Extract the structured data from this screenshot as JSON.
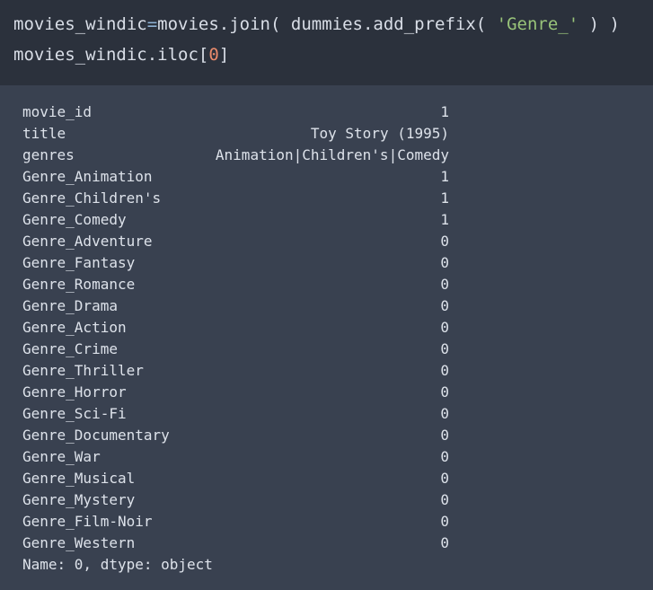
{
  "code": {
    "line1": {
      "a": "movies_windic",
      "eq": "=",
      "b": "movies.join( dummies.add_prefix( ",
      "str": "'Genre_'",
      "c": " ) )"
    },
    "line2": {
      "a": "movies_windic.iloc[",
      "num": "0",
      "b": "]"
    }
  },
  "output": {
    "rows": [
      {
        "key": "movie_id",
        "value": "1"
      },
      {
        "key": "title",
        "value": "Toy Story (1995)"
      },
      {
        "key": "genres",
        "value": "Animation|Children's|Comedy"
      },
      {
        "key": "Genre_Animation",
        "value": "1"
      },
      {
        "key": "Genre_Children's",
        "value": "1"
      },
      {
        "key": "Genre_Comedy",
        "value": "1"
      },
      {
        "key": "Genre_Adventure",
        "value": "0"
      },
      {
        "key": "Genre_Fantasy",
        "value": "0"
      },
      {
        "key": "Genre_Romance",
        "value": "0"
      },
      {
        "key": "Genre_Drama",
        "value": "0"
      },
      {
        "key": "Genre_Action",
        "value": "0"
      },
      {
        "key": "Genre_Crime",
        "value": "0"
      },
      {
        "key": "Genre_Thriller",
        "value": "0"
      },
      {
        "key": "Genre_Horror",
        "value": "0"
      },
      {
        "key": "Genre_Sci-Fi",
        "value": "0"
      },
      {
        "key": "Genre_Documentary",
        "value": "0"
      },
      {
        "key": "Genre_War",
        "value": "0"
      },
      {
        "key": "Genre_Musical",
        "value": "0"
      },
      {
        "key": "Genre_Mystery",
        "value": "0"
      },
      {
        "key": "Genre_Film-Noir",
        "value": "0"
      },
      {
        "key": "Genre_Western",
        "value": "0"
      }
    ],
    "footer": "Name: 0, dtype: object"
  },
  "colors": {
    "code_bg": "#2b313c",
    "output_bg": "#394150",
    "string": "#98c379",
    "number": "#e88a6b",
    "operator": "#8fb3d6"
  }
}
